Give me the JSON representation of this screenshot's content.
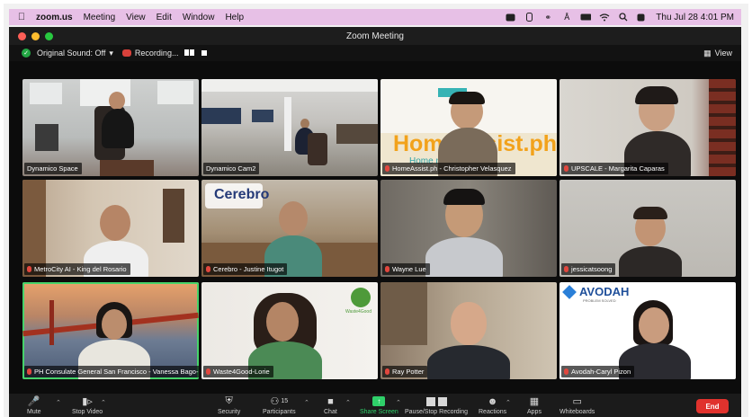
{
  "menubar": {
    "app": "zoom.us",
    "menus": [
      "Meeting",
      "View",
      "Edit",
      "Window",
      "Help"
    ],
    "clock": "Thu Jul 28  4:01 PM"
  },
  "window": {
    "title": "Zoom Meeting"
  },
  "infobar": {
    "original_sound": "Original Sound: Off",
    "recording": "Recording...",
    "view": "View"
  },
  "participants": [
    {
      "name": "Dynamico Space",
      "muted": false
    },
    {
      "name": "Dynamico Cam2",
      "muted": false
    },
    {
      "name": "HomeAssist.ph - Christopher Velasquez",
      "muted": true
    },
    {
      "name": "UPSCALE - Margarita Caparas",
      "muted": true
    },
    {
      "name": "MetroCity AI - King del Rosario",
      "muted": true
    },
    {
      "name": "Cerebro - Justine Itugot",
      "muted": true
    },
    {
      "name": "Wayne Lue",
      "muted": true
    },
    {
      "name": "jessicatsoong",
      "muted": true
    },
    {
      "name": "PH Consulate General San Francisco - Vanessa Bago-Li...",
      "muted": true
    },
    {
      "name": "Waste4Good-Lorie",
      "muted": true
    },
    {
      "name": "Ray Potter",
      "muted": true
    },
    {
      "name": "Avodah-Caryl Pizon",
      "muted": true
    }
  ],
  "backgrounds": {
    "homeassist_logo": "HomeAssist.ph",
    "homeassist_tagline": "Home made easy.",
    "cerebro_logo": "Cerebro",
    "avodah_logo": "AVODAH",
    "avodah_tagline": "PROBLEM SOLVED",
    "waste4good_logo": "Waste4Good"
  },
  "toolbar": {
    "mute": "Mute",
    "stop_video": "Stop Video",
    "security": "Security",
    "participants": "Participants",
    "participants_count": "15",
    "chat": "Chat",
    "share_screen": "Share Screen",
    "pause_recording": "Pause/Stop Recording",
    "reactions": "Reactions",
    "apps": "Apps",
    "whiteboards": "Whiteboards",
    "end": "End"
  },
  "colors": {
    "menubar_bg": "#e7c0e6",
    "active_speaker_border": "#46d36a",
    "end_button": "#e0322d",
    "share_green": "#2fd06a"
  }
}
